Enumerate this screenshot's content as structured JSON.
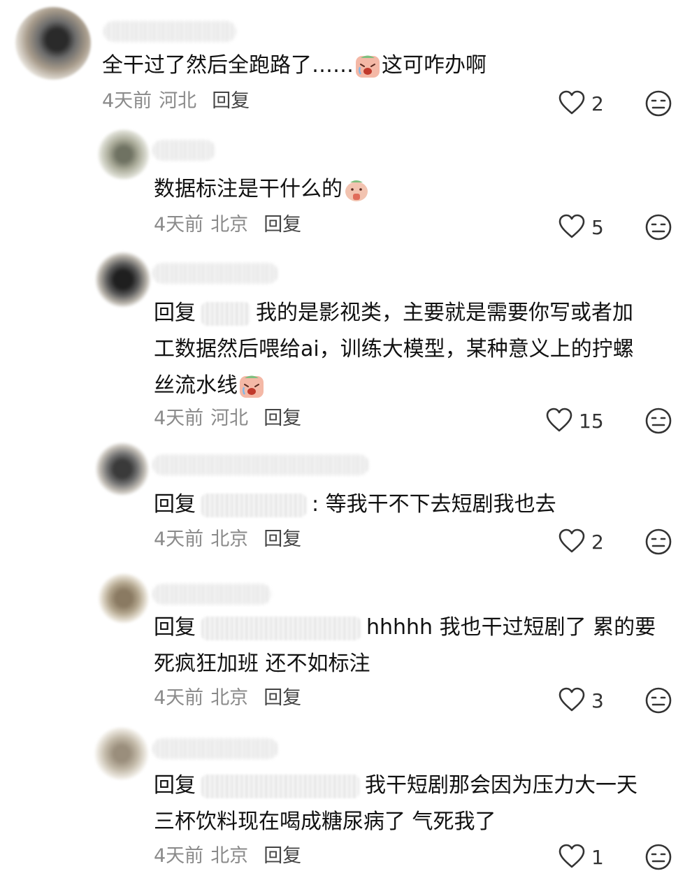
{
  "comments": [
    {
      "text_lines": [
        "全干过了然后全跑路了……",
        "这可咋办啊"
      ],
      "time": "4天前",
      "location": "河北",
      "reply_label": "回复",
      "likes": "2"
    },
    {
      "text_lines": [
        "数据标注是干什么的"
      ],
      "time": "4天前",
      "location": "北京",
      "reply_label": "回复",
      "likes": "5"
    },
    {
      "prefix": "回复",
      "text_lines": [
        "我的是影视类，主要就是需要你写或者加",
        "工数据然后喂给ai，训练大模型，某种意义上的拧螺",
        "丝流水线"
      ],
      "time": "4天前",
      "location": "河北",
      "reply_label": "回复",
      "likes": "15"
    },
    {
      "prefix": "回复",
      "text_lines": [
        ": 等我干不下去短剧我也去"
      ],
      "time": "4天前",
      "location": "北京",
      "reply_label": "回复",
      "likes": "2"
    },
    {
      "prefix": "回复",
      "text_lines": [
        "hhhhh 我也干过短剧了 累的要",
        "死疯狂加班 还不如标注"
      ],
      "time": "4天前",
      "location": "北京",
      "reply_label": "回复",
      "likes": "3"
    },
    {
      "prefix": "回复",
      "text_lines": [
        "我干短剧那会因为压力大一天",
        "三杯饮料现在喝成糖尿病了 气死我了"
      ],
      "time": "4天前",
      "location": "北京",
      "reply_label": "回复",
      "likes": "1"
    }
  ],
  "icons": {
    "like": "heart-outline-icon",
    "dislike": "neutral-face-icon",
    "emoji_cry": "crying-emoji",
    "emoji_beg": "begging-emoji"
  },
  "colors": {
    "text": "#111111",
    "meta": "#8a8a8a",
    "reply": "#444444",
    "icon": "#333333"
  }
}
